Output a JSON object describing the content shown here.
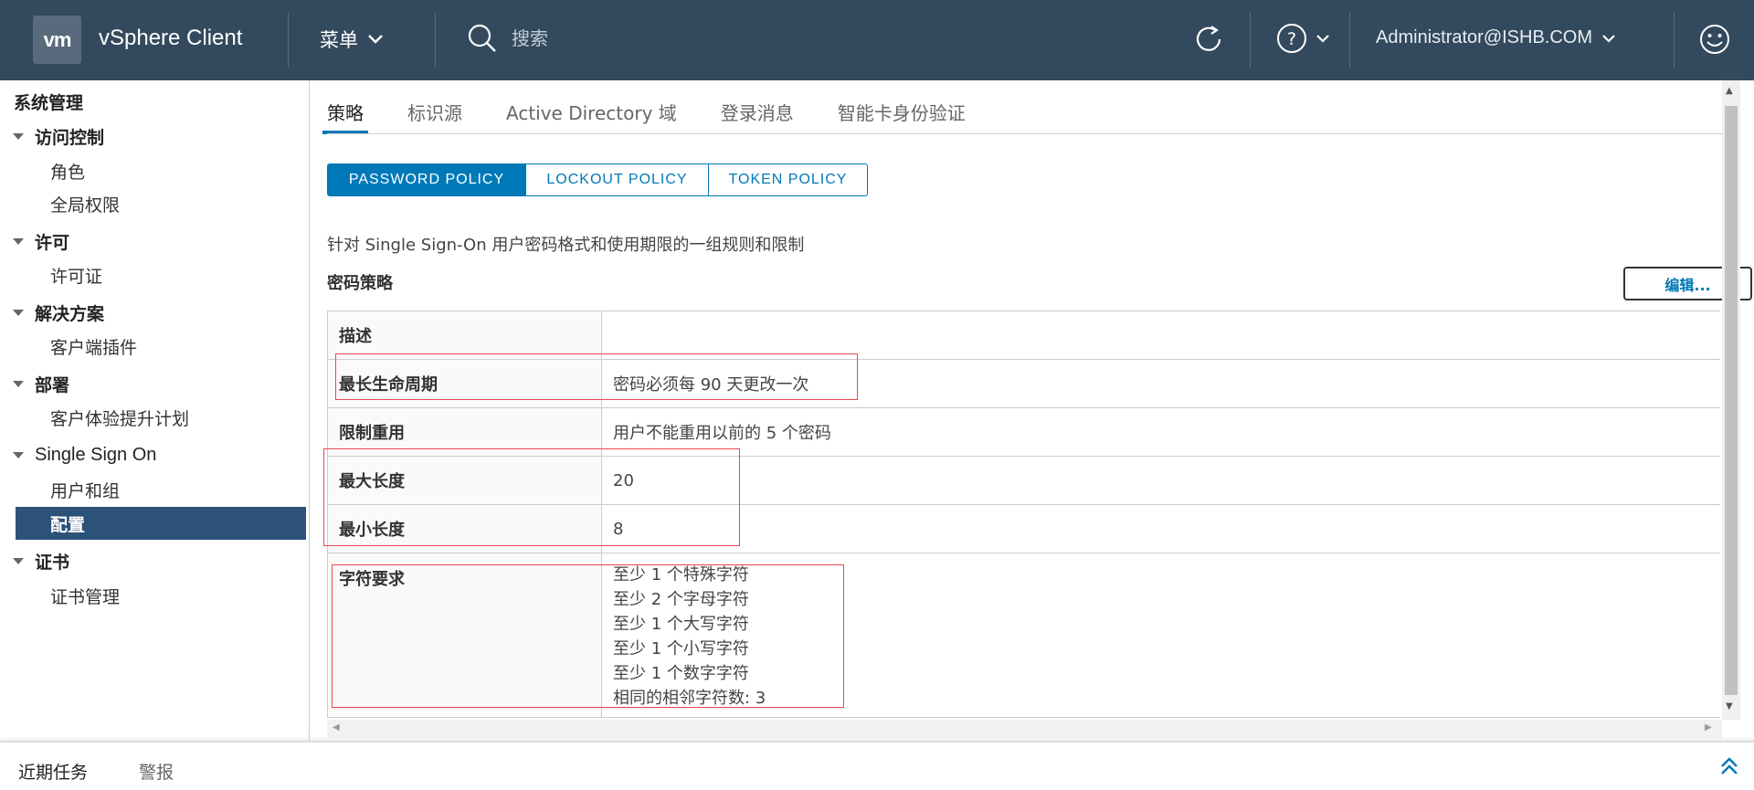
{
  "header": {
    "logo": "vm",
    "app_title": "vSphere Client",
    "menu_label": "菜单",
    "search_placeholder": "搜索",
    "user": "Administrator@ISHB.COM",
    "icons": [
      "refresh-icon",
      "help-icon",
      "smiley-icon"
    ]
  },
  "sidebar": {
    "root": "系统管理",
    "groups": [
      {
        "label": "访问控制",
        "items": [
          "角色",
          "全局权限"
        ]
      },
      {
        "label": "许可",
        "items": [
          "许可证"
        ]
      },
      {
        "label": "解决方案",
        "items": [
          "客户端插件"
        ]
      },
      {
        "label": "部署",
        "items": [
          "客户体验提升计划"
        ]
      },
      {
        "label": "Single Sign On",
        "items": [
          "用户和组",
          "配置"
        ]
      },
      {
        "label": "证书",
        "items": [
          "证书管理"
        ]
      }
    ],
    "active_item": "配置"
  },
  "tabs": [
    "策略",
    "标识源",
    "Active Directory 域",
    "登录消息",
    "智能卡身份验证"
  ],
  "active_tab": "策略",
  "policy_buttons": [
    "PASSWORD POLICY",
    "LOCKOUT POLICY",
    "TOKEN POLICY"
  ],
  "selected_policy_button": "PASSWORD POLICY",
  "description": "针对 Single Sign-On 用户密码格式和使用期限的一组规则和限制",
  "section_title": "密码策略",
  "edit_label": "编辑...",
  "policy_table": [
    {
      "key": "描述",
      "value": ""
    },
    {
      "key": "最长生命周期",
      "value": "密码必须每 90 天更改一次"
    },
    {
      "key": "限制重用",
      "value": "用户不能重用以前的 5 个密码"
    },
    {
      "key": "最大长度",
      "value": "20"
    },
    {
      "key": "最小长度",
      "value": "8"
    }
  ],
  "char_requirements": {
    "key": "字符要求",
    "lines": [
      "至少 1 个特殊字符",
      "至少 2 个字母字符",
      "至少 1 个大写字符",
      "至少 1 个小写字符",
      "至少 1 个数字字符",
      "相同的相邻字符数: 3"
    ]
  },
  "bottom_bar": {
    "tabs": [
      "近期任务",
      "警报"
    ]
  },
  "colors": {
    "header_bg": "#334a5e",
    "accent": "#0079b8",
    "active_nav_bg": "#2c5279",
    "highlight_box": "#e8474b"
  }
}
